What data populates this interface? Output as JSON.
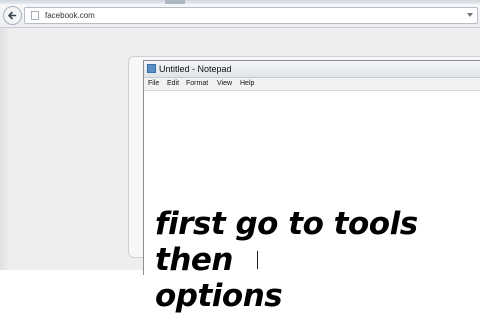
{
  "browser": {
    "url": "facebook.com",
    "icons": [
      "back-arrow-icon",
      "page-icon",
      "dropdown-arrow-icon"
    ]
  },
  "notepad": {
    "title": "Untitled - Notepad",
    "menu": [
      "File",
      "Edit",
      "Format",
      "View",
      "Help"
    ]
  },
  "caption": {
    "line1": "first go to tools then",
    "line2": "options"
  }
}
